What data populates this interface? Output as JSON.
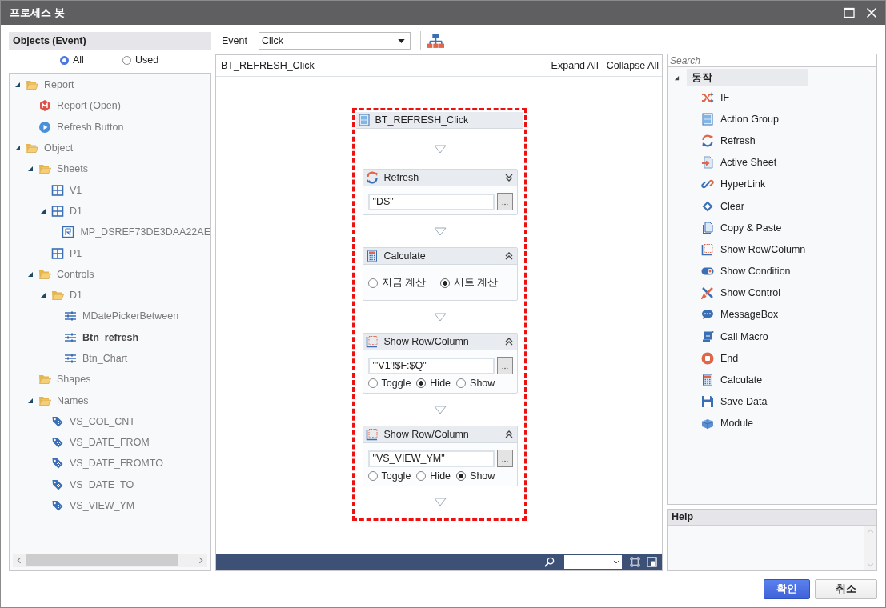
{
  "window": {
    "title": "프로세스 봇"
  },
  "objects": {
    "title": "Objects (Event)",
    "filters": [
      {
        "label": "All",
        "selected": true
      },
      {
        "label": "Used",
        "selected": false
      }
    ],
    "tree": [
      {
        "label": "Report",
        "kind": "folder",
        "expanded": true,
        "selected": false,
        "children": [
          {
            "label": "Report (Open)",
            "kind": "report",
            "expanded": false,
            "selected": false
          },
          {
            "label": "Refresh Button",
            "kind": "button",
            "expanded": false,
            "selected": false
          }
        ]
      },
      {
        "label": "Object",
        "kind": "folder",
        "expanded": true,
        "selected": false,
        "children": [
          {
            "label": "Sheets",
            "kind": "folder",
            "expanded": true,
            "selected": false,
            "children": [
              {
                "label": "V1",
                "kind": "sheet",
                "expanded": false,
                "selected": false
              },
              {
                "label": "D1",
                "kind": "sheet",
                "expanded": true,
                "selected": false,
                "children": [
                  {
                    "label": "MP_DSREF73DE3DAA22AE",
                    "kind": "map",
                    "expanded": false,
                    "selected": false
                  }
                ]
              },
              {
                "label": "P1",
                "kind": "sheet",
                "expanded": false,
                "selected": false
              }
            ]
          },
          {
            "label": "Controls",
            "kind": "folder",
            "expanded": true,
            "selected": false,
            "children": [
              {
                "label": "D1",
                "kind": "folder",
                "expanded": true,
                "selected": false,
                "children": [
                  {
                    "label": "MDatePickerBetween",
                    "kind": "control",
                    "expanded": false,
                    "selected": false
                  },
                  {
                    "label": "Btn_refresh",
                    "kind": "control",
                    "expanded": false,
                    "selected": true
                  },
                  {
                    "label": "Btn_Chart",
                    "kind": "control",
                    "expanded": false,
                    "selected": false
                  }
                ]
              }
            ]
          },
          {
            "label": "Shapes",
            "kind": "folder",
            "expanded": false,
            "selected": false
          },
          {
            "label": "Names",
            "kind": "folder",
            "expanded": true,
            "selected": false,
            "children": [
              {
                "label": "VS_COL_CNT",
                "kind": "name",
                "expanded": false,
                "selected": false
              },
              {
                "label": "VS_DATE_FROM",
                "kind": "name",
                "expanded": false,
                "selected": false
              },
              {
                "label": "VS_DATE_FROMTO",
                "kind": "name",
                "expanded": false,
                "selected": false
              },
              {
                "label": "VS_DATE_TO",
                "kind": "name",
                "expanded": false,
                "selected": false
              },
              {
                "label": "VS_VIEW_YM",
                "kind": "name",
                "expanded": false,
                "selected": false
              }
            ]
          }
        ]
      }
    ]
  },
  "event": {
    "label": "Event",
    "value": "Click"
  },
  "flow": {
    "name": "BT_REFRESH_Click",
    "expand_all": "Expand All",
    "collapse_all": "Collapse All",
    "block_title": "BT_REFRESH_Click",
    "actions": [
      {
        "kind": "refresh",
        "title": "Refresh",
        "expanded": false,
        "field": "\"DS\""
      },
      {
        "kind": "calculate",
        "title": "Calculate",
        "expanded": true,
        "options": [
          {
            "label": "지금 계산",
            "selected": false
          },
          {
            "label": "시트 계산",
            "selected": true
          }
        ]
      },
      {
        "kind": "show_row_column",
        "title": "Show Row/Column",
        "expanded": true,
        "field": "\"'V1'!$F:$Q\"",
        "options": [
          {
            "label": "Toggle",
            "selected": false
          },
          {
            "label": "Hide",
            "selected": true
          },
          {
            "label": "Show",
            "selected": false
          }
        ]
      },
      {
        "kind": "show_row_column",
        "title": "Show Row/Column",
        "expanded": true,
        "field": "\"VS_VIEW_YM\"",
        "options": [
          {
            "label": "Toggle",
            "selected": false
          },
          {
            "label": "Hide",
            "selected": false
          },
          {
            "label": "Show",
            "selected": true
          }
        ]
      }
    ]
  },
  "actions_panel": {
    "search_placeholder": "Search",
    "group": {
      "label": "동작",
      "expanded": true,
      "items": [
        {
          "label": "IF",
          "kind": "if"
        },
        {
          "label": "Action Group",
          "kind": "group"
        },
        {
          "label": "Refresh",
          "kind": "refresh"
        },
        {
          "label": "Active Sheet",
          "kind": "active_sheet"
        },
        {
          "label": "HyperLink",
          "kind": "hyperlink"
        },
        {
          "label": "Clear",
          "kind": "clear"
        },
        {
          "label": "Copy & Paste",
          "kind": "copy"
        },
        {
          "label": "Show Row/Column",
          "kind": "show_row_column"
        },
        {
          "label": "Show Condition",
          "kind": "show_condition"
        },
        {
          "label": "Show Control",
          "kind": "show_control"
        },
        {
          "label": "MessageBox",
          "kind": "messagebox"
        },
        {
          "label": "Call Macro",
          "kind": "call_macro"
        },
        {
          "label": "End",
          "kind": "end"
        },
        {
          "label": "Calculate",
          "kind": "calculate"
        },
        {
          "label": "Save Data",
          "kind": "save"
        },
        {
          "label": "Module",
          "kind": "module"
        }
      ]
    }
  },
  "help": {
    "title": "Help"
  },
  "buttons": [
    {
      "label": "확인",
      "kind": "primary"
    },
    {
      "label": "취소",
      "kind": "secondary"
    }
  ]
}
